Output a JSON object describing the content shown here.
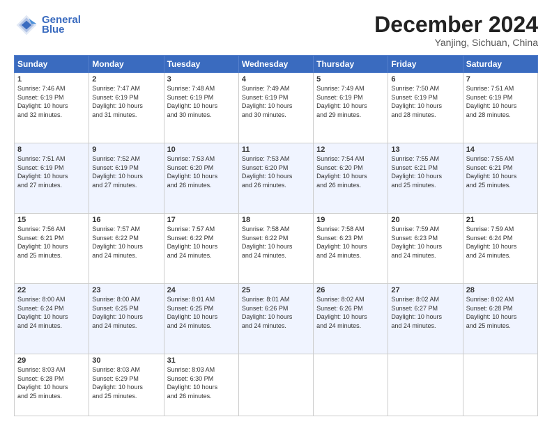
{
  "header": {
    "logo_line1": "General",
    "logo_line2": "Blue",
    "month_title": "December 2024",
    "subtitle": "Yanjing, Sichuan, China"
  },
  "days_of_week": [
    "Sunday",
    "Monday",
    "Tuesday",
    "Wednesday",
    "Thursday",
    "Friday",
    "Saturday"
  ],
  "weeks": [
    [
      {
        "day": "1",
        "info": "Sunrise: 7:46 AM\nSunset: 6:19 PM\nDaylight: 10 hours\nand 32 minutes."
      },
      {
        "day": "2",
        "info": "Sunrise: 7:47 AM\nSunset: 6:19 PM\nDaylight: 10 hours\nand 31 minutes."
      },
      {
        "day": "3",
        "info": "Sunrise: 7:48 AM\nSunset: 6:19 PM\nDaylight: 10 hours\nand 30 minutes."
      },
      {
        "day": "4",
        "info": "Sunrise: 7:49 AM\nSunset: 6:19 PM\nDaylight: 10 hours\nand 30 minutes."
      },
      {
        "day": "5",
        "info": "Sunrise: 7:49 AM\nSunset: 6:19 PM\nDaylight: 10 hours\nand 29 minutes."
      },
      {
        "day": "6",
        "info": "Sunrise: 7:50 AM\nSunset: 6:19 PM\nDaylight: 10 hours\nand 28 minutes."
      },
      {
        "day": "7",
        "info": "Sunrise: 7:51 AM\nSunset: 6:19 PM\nDaylight: 10 hours\nand 28 minutes."
      }
    ],
    [
      {
        "day": "8",
        "info": "Sunrise: 7:51 AM\nSunset: 6:19 PM\nDaylight: 10 hours\nand 27 minutes."
      },
      {
        "day": "9",
        "info": "Sunrise: 7:52 AM\nSunset: 6:19 PM\nDaylight: 10 hours\nand 27 minutes."
      },
      {
        "day": "10",
        "info": "Sunrise: 7:53 AM\nSunset: 6:20 PM\nDaylight: 10 hours\nand 26 minutes."
      },
      {
        "day": "11",
        "info": "Sunrise: 7:53 AM\nSunset: 6:20 PM\nDaylight: 10 hours\nand 26 minutes."
      },
      {
        "day": "12",
        "info": "Sunrise: 7:54 AM\nSunset: 6:20 PM\nDaylight: 10 hours\nand 26 minutes."
      },
      {
        "day": "13",
        "info": "Sunrise: 7:55 AM\nSunset: 6:21 PM\nDaylight: 10 hours\nand 25 minutes."
      },
      {
        "day": "14",
        "info": "Sunrise: 7:55 AM\nSunset: 6:21 PM\nDaylight: 10 hours\nand 25 minutes."
      }
    ],
    [
      {
        "day": "15",
        "info": "Sunrise: 7:56 AM\nSunset: 6:21 PM\nDaylight: 10 hours\nand 25 minutes."
      },
      {
        "day": "16",
        "info": "Sunrise: 7:57 AM\nSunset: 6:22 PM\nDaylight: 10 hours\nand 24 minutes."
      },
      {
        "day": "17",
        "info": "Sunrise: 7:57 AM\nSunset: 6:22 PM\nDaylight: 10 hours\nand 24 minutes."
      },
      {
        "day": "18",
        "info": "Sunrise: 7:58 AM\nSunset: 6:22 PM\nDaylight: 10 hours\nand 24 minutes."
      },
      {
        "day": "19",
        "info": "Sunrise: 7:58 AM\nSunset: 6:23 PM\nDaylight: 10 hours\nand 24 minutes."
      },
      {
        "day": "20",
        "info": "Sunrise: 7:59 AM\nSunset: 6:23 PM\nDaylight: 10 hours\nand 24 minutes."
      },
      {
        "day": "21",
        "info": "Sunrise: 7:59 AM\nSunset: 6:24 PM\nDaylight: 10 hours\nand 24 minutes."
      }
    ],
    [
      {
        "day": "22",
        "info": "Sunrise: 8:00 AM\nSunset: 6:24 PM\nDaylight: 10 hours\nand 24 minutes."
      },
      {
        "day": "23",
        "info": "Sunrise: 8:00 AM\nSunset: 6:25 PM\nDaylight: 10 hours\nand 24 minutes."
      },
      {
        "day": "24",
        "info": "Sunrise: 8:01 AM\nSunset: 6:25 PM\nDaylight: 10 hours\nand 24 minutes."
      },
      {
        "day": "25",
        "info": "Sunrise: 8:01 AM\nSunset: 6:26 PM\nDaylight: 10 hours\nand 24 minutes."
      },
      {
        "day": "26",
        "info": "Sunrise: 8:02 AM\nSunset: 6:26 PM\nDaylight: 10 hours\nand 24 minutes."
      },
      {
        "day": "27",
        "info": "Sunrise: 8:02 AM\nSunset: 6:27 PM\nDaylight: 10 hours\nand 24 minutes."
      },
      {
        "day": "28",
        "info": "Sunrise: 8:02 AM\nSunset: 6:28 PM\nDaylight: 10 hours\nand 25 minutes."
      }
    ],
    [
      {
        "day": "29",
        "info": "Sunrise: 8:03 AM\nSunset: 6:28 PM\nDaylight: 10 hours\nand 25 minutes."
      },
      {
        "day": "30",
        "info": "Sunrise: 8:03 AM\nSunset: 6:29 PM\nDaylight: 10 hours\nand 25 minutes."
      },
      {
        "day": "31",
        "info": "Sunrise: 8:03 AM\nSunset: 6:30 PM\nDaylight: 10 hours\nand 26 minutes."
      },
      {
        "day": "",
        "info": ""
      },
      {
        "day": "",
        "info": ""
      },
      {
        "day": "",
        "info": ""
      },
      {
        "day": "",
        "info": ""
      }
    ]
  ]
}
